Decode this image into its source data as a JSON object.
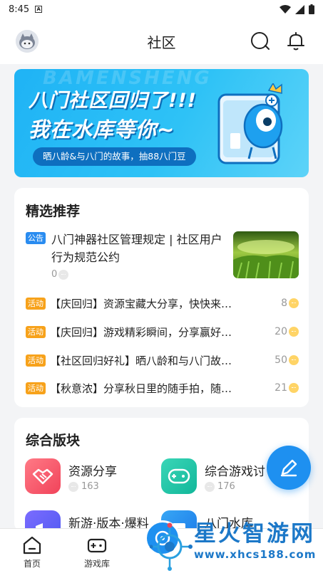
{
  "status_bar": {
    "time": "8:45",
    "notif_letter": "A"
  },
  "header": {
    "title": "社区"
  },
  "banner": {
    "watermark_word": "BAMENSHENG",
    "line1": "八门社区回归了!!!",
    "line2": "我在水库等你~",
    "pill": "晒八龄&与八门的故事，抽88八门豆"
  },
  "featured": {
    "title": "精选推荐",
    "notice": {
      "tag": "公告",
      "title": "八门神器社区管理规定 | 社区用户行为规范公约",
      "count": "0"
    },
    "posts": [
      {
        "tag": "活动",
        "title": "【庆回归】资源宝藏大分享，快快来…",
        "count": "8"
      },
      {
        "tag": "活动",
        "title": "【庆回归】游戏精彩瞬间，分享赢好…",
        "count": "20"
      },
      {
        "tag": "活动",
        "title": "【社区回归好礼】晒八龄和与八门故…",
        "count": "50"
      },
      {
        "tag": "活动",
        "title": "【秋意浓】分享秋日里的随手拍，随…",
        "count": "21"
      }
    ]
  },
  "boards": {
    "title": "综合版块",
    "items": [
      {
        "name": "资源分享",
        "count": "163",
        "icon": "handshake-icon"
      },
      {
        "name": "综合游戏讨",
        "count": "176",
        "icon": "gamepad-icon"
      },
      {
        "name": "新游·版本·爆料",
        "count": "",
        "icon": "megaphone-icon"
      },
      {
        "name": "八门水库",
        "count": "",
        "icon": "reservoir-icon"
      }
    ]
  },
  "bottom_nav": {
    "items": [
      {
        "label": "首页",
        "icon": "home-icon"
      },
      {
        "label": "游戏库",
        "icon": "game-library-icon"
      },
      {
        "label": "",
        "icon": "community-icon"
      }
    ]
  },
  "watermark": {
    "text": "星火智游网",
    "url": "www.xhcs188.com"
  },
  "colors": {
    "accent": "#1e90f0",
    "tag_blue": "#2a8cf0",
    "tag_orange": "#f7a21b",
    "page_bg": "#f3f4f6"
  }
}
